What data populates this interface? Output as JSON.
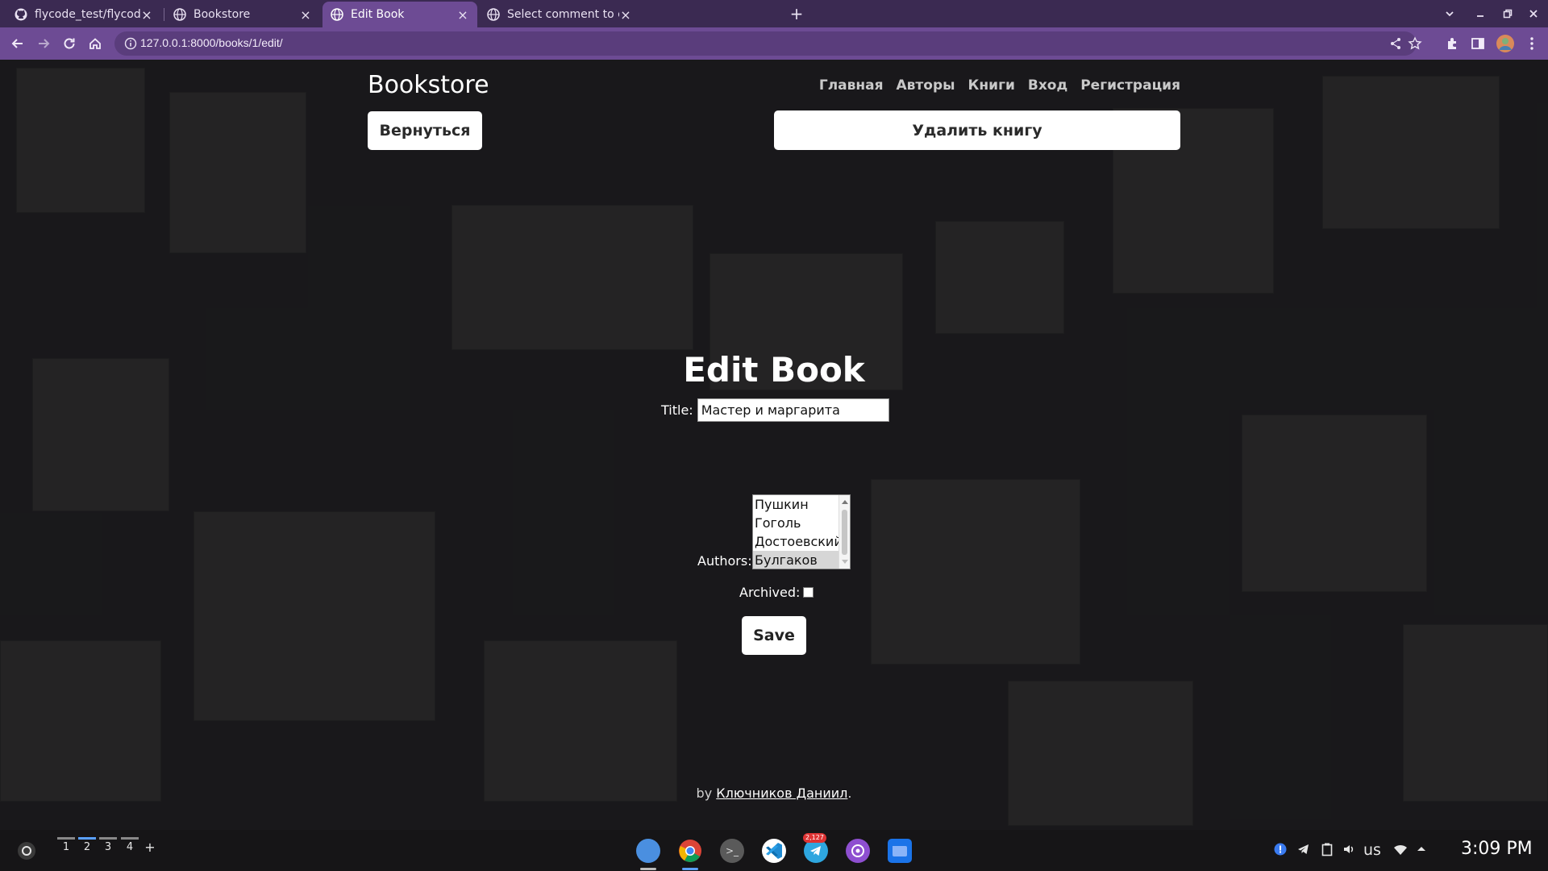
{
  "browser": {
    "tabs": [
      {
        "label": "flycode_test/flycode_test at",
        "icon": "github-icon",
        "active": false
      },
      {
        "label": "Bookstore",
        "icon": "globe-icon",
        "active": false
      },
      {
        "label": "Edit Book",
        "icon": "globe-icon",
        "active": true
      },
      {
        "label": "Select comment to change |",
        "icon": "globe-icon",
        "active": false
      }
    ],
    "url": "127.0.0.1:8000/books/1/edit/",
    "colors": {
      "tabbar": "#3b2a52",
      "toolbar": "#6d4b94"
    }
  },
  "site": {
    "brand": "Bookstore",
    "nav": [
      "Главная",
      "Авторы",
      "Книги",
      "Вход",
      "Регистрация"
    ],
    "back_label": "Вернуться",
    "delete_label": "Удалить книгу"
  },
  "form": {
    "heading": "Edit Book",
    "title_label": "Title:",
    "title_value": "Мастер и маргарита",
    "authors_label": "Authors:",
    "authors": [
      {
        "name": "Пушкин",
        "selected": false
      },
      {
        "name": "Гоголь",
        "selected": false
      },
      {
        "name": "Достоевский",
        "selected": false
      },
      {
        "name": "Булгаков",
        "selected": true
      }
    ],
    "archived_label": "Archived:",
    "archived": false,
    "save_label": "Save"
  },
  "footer": {
    "prefix": "by",
    "author_link": "Ключников Даниил",
    "suffix": "."
  },
  "shelf": {
    "desks": [
      "1",
      "2",
      "3",
      "4"
    ],
    "add_desk": "+",
    "apps": [
      "files-icon",
      "chrome-icon",
      "terminal-icon",
      "vscode-icon",
      "telegram-icon",
      "podcast-icon",
      "folder-icon"
    ],
    "telegram_badge": "2,127",
    "locale": "us",
    "time": "3:09 PM"
  }
}
